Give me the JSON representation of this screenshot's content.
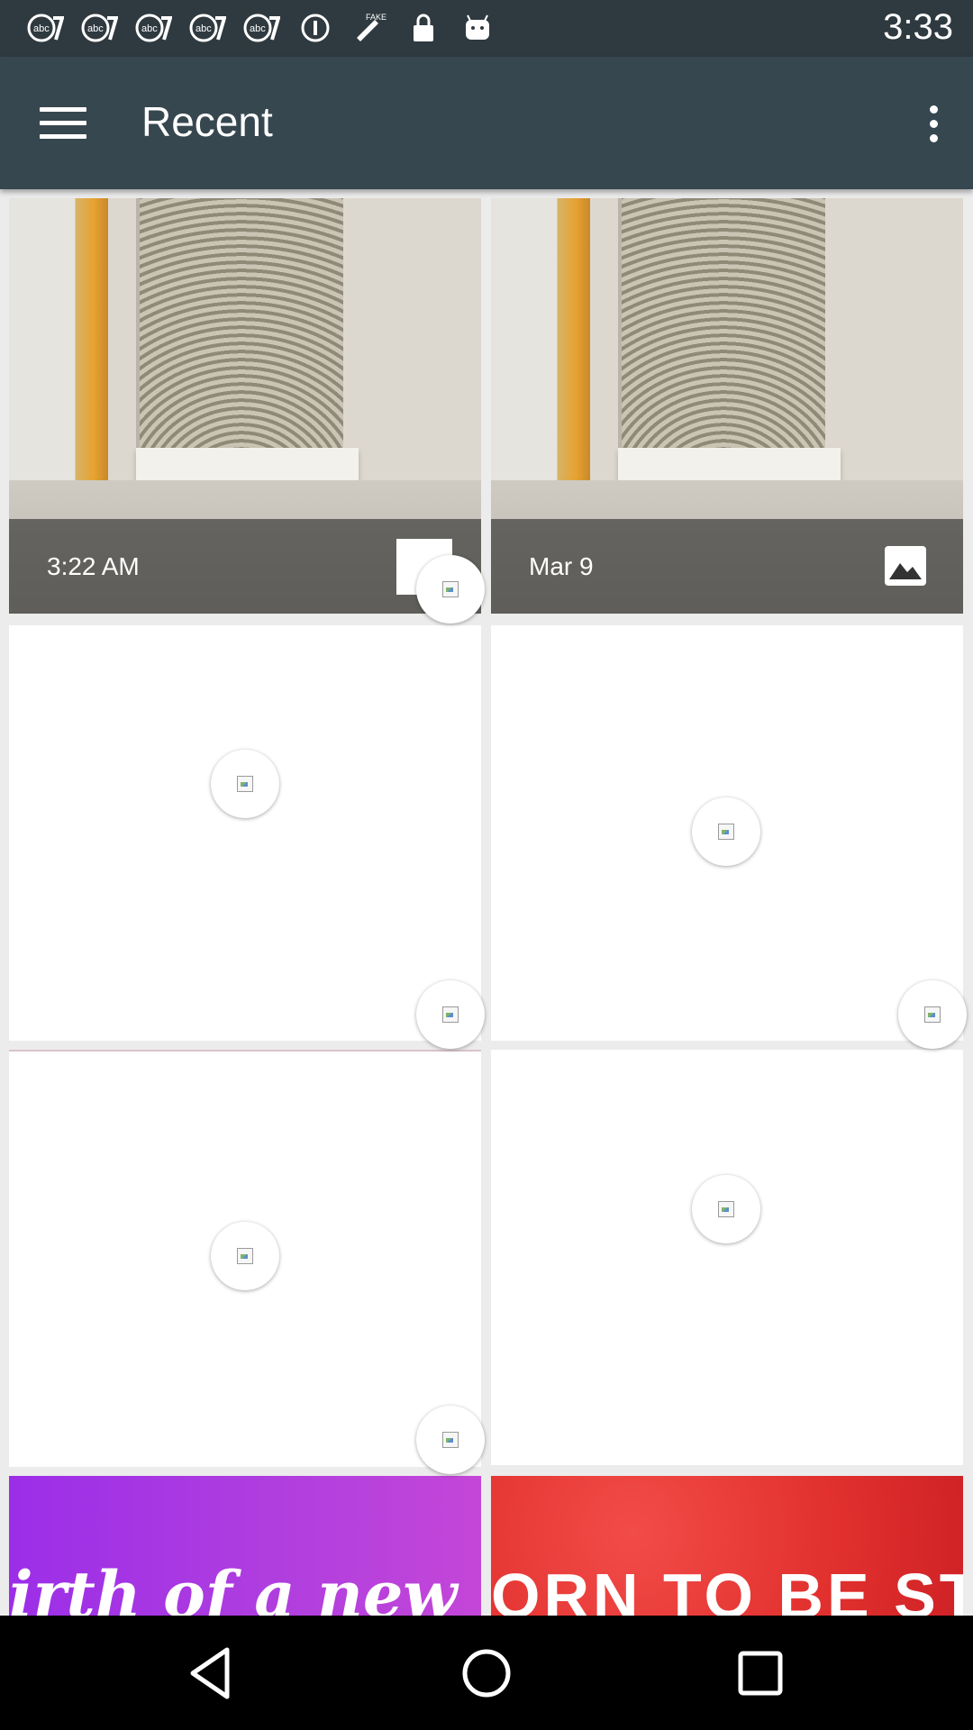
{
  "status_bar": {
    "time": "3:33",
    "notification_icons": [
      "abc7-icon",
      "abc7-icon",
      "abc7-icon",
      "abc7-icon",
      "abc7-icon",
      "info-icon",
      "fake-gps-icon",
      "lock-icon",
      "android-icon"
    ]
  },
  "app_bar": {
    "title": "Recent",
    "menu_icon": "hamburger-menu-icon",
    "overflow_icon": "more-vert-icon",
    "background": "#37474f"
  },
  "tiles": [
    {
      "kind": "photo",
      "caption": "3:22 AM"
    },
    {
      "kind": "photo",
      "caption": "Mar 9",
      "badge": "image-icon"
    },
    {
      "kind": "loading"
    },
    {
      "kind": "loading"
    },
    {
      "kind": "loading"
    },
    {
      "kind": "loading"
    },
    {
      "kind": "banner",
      "text": "irth of a new Y",
      "color": "#a93de3"
    },
    {
      "kind": "banner",
      "text": "ORN TO BE STRON",
      "color": "#e1302e"
    }
  ],
  "nav_bar": {
    "back_icon": "back-triangle-icon",
    "home_icon": "home-circle-icon",
    "recents_icon": "recents-square-icon"
  }
}
